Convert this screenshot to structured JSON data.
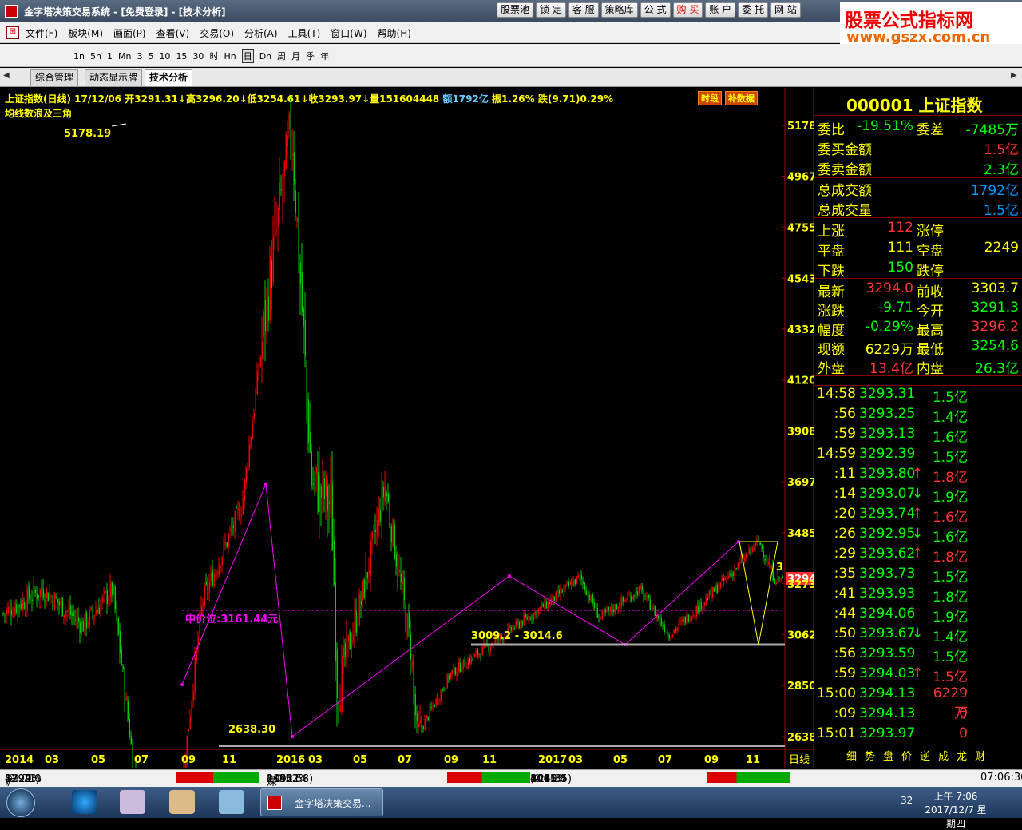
{
  "window": {
    "title": "金字塔决策交易系统 - [免费登录] - [技术分析]"
  },
  "topbuttons": [
    "股票池",
    "锁 定",
    "客 服",
    "策略库",
    "公 式",
    "购 买",
    "账 户",
    "委 托",
    "网 站"
  ],
  "watermark": {
    "line1": "股票公式指标网",
    "line2": "www.gszx.com.cn"
  },
  "menu": [
    "文件(F)",
    "板块(M)",
    "画面(P)",
    "查看(V)",
    "交易(O)",
    "分析(A)",
    "工具(T)",
    "窗口(W)",
    "帮助(H)"
  ],
  "periods": [
    "1n",
    "5n",
    "1",
    "Mn",
    "3",
    "5",
    "10",
    "15",
    "30",
    "时",
    "Hn",
    "日",
    "Dn",
    "周",
    "月",
    "季",
    "年"
  ],
  "tabs": [
    "综合管理",
    "动态显示牌",
    "技术分析"
  ],
  "chart": {
    "header": {
      "name": "上证指数(日线)",
      "date": "17/12/06",
      "open": "开3291.31",
      "high": "↓高3296.20",
      "low": "↓低3254.61",
      "close": "↓收3293.97",
      "vol": "↓量151604448",
      "amt": "额1792亿",
      "amp": "振1.26%",
      "chg": "跌(9.71)0.29%"
    },
    "indicator": "均线数浪及三角",
    "buttons": [
      "时段",
      "补数据"
    ],
    "annotations": {
      "peak": "5178.19",
      "trough": "2638.30",
      "price_level": "中价位:3161.44元",
      "range": "3009.2 - 3014.6",
      "current": "3294",
      "edge": "3"
    },
    "y_ticks": [
      "5178",
      "4967",
      "4755",
      "4543",
      "4332",
      "4120",
      "3908",
      "3697",
      "3485",
      "3273",
      "3062",
      "2850",
      "2638"
    ],
    "x_ticks": [
      "2014",
      "03",
      "05",
      "07",
      "09",
      "11",
      "2016",
      "03",
      "05",
      "07",
      "09",
      "11",
      "2017",
      "03",
      "05",
      "07",
      "09",
      "11"
    ],
    "period_label": "日线"
  },
  "chart_data": {
    "type": "candlestick",
    "series": [
      {
        "name": "上证指数(日线)",
        "points": [
          [
            2014.7,
            2200
          ],
          [
            2014.9,
            2450
          ],
          [
            2015.0,
            3200
          ],
          [
            2015.2,
            3600
          ],
          [
            2015.35,
            4600
          ],
          [
            2015.45,
            5178.19
          ],
          [
            2015.55,
            3700
          ],
          [
            2015.65,
            3600
          ],
          [
            2015.68,
            2850
          ],
          [
            2015.8,
            3200
          ],
          [
            2015.92,
            3680
          ],
          [
            2016.05,
            3000
          ],
          [
            2016.08,
            2638.3
          ],
          [
            2016.25,
            2900
          ],
          [
            2016.5,
            3050
          ],
          [
            2016.75,
            3200
          ],
          [
            2016.9,
            3301
          ],
          [
            2017.0,
            3130
          ],
          [
            2017.2,
            3250
          ],
          [
            2017.35,
            3060
          ],
          [
            2017.5,
            3180
          ],
          [
            2017.7,
            3350
          ],
          [
            2017.8,
            3450
          ],
          [
            2017.88,
            3294
          ]
        ]
      }
    ],
    "ylim": [
      2638,
      5178
    ]
  },
  "right_panel": {
    "code": "000001",
    "name": "上证指数",
    "rows": [
      {
        "l1": "委比",
        "v1": "-19.51%",
        "l2": "委差",
        "v2": "-7485万"
      },
      {
        "l1": "委买金额",
        "v1": "1.5亿"
      },
      {
        "l1": "委卖金额",
        "v1": "2.3亿"
      },
      {
        "l1": "总成交额",
        "v1": "1792亿"
      },
      {
        "l1": "总成交量",
        "v1": "1.5亿"
      },
      {
        "l1": "上涨",
        "v1": "112",
        "l2": "涨停",
        "v2": ""
      },
      {
        "l1": "平盘",
        "v1": "111",
        "l2": "空盘",
        "v2": "2249"
      },
      {
        "l1": "下跌",
        "v1": "150",
        "l2": "跌停",
        "v2": ""
      },
      {
        "l1": "最新",
        "v1": "3294.0",
        "l2": "前收",
        "v2": "3303.7"
      },
      {
        "l1": "涨跌",
        "v1": "-9.71",
        "l2": "今开",
        "v2": "3291.3"
      },
      {
        "l1": "幅度",
        "v1": "-0.29%",
        "l2": "最高",
        "v2": "3296.2"
      },
      {
        "l1": "现额",
        "v1": "6229万",
        "l2": "最低",
        "v2": "3254.6"
      },
      {
        "l1": "外盘",
        "v1": "13.4亿",
        "l2": "内盘",
        "v2": "26.3亿"
      }
    ],
    "ticks": [
      {
        "t": "14:58",
        "p": "3293.31",
        "a": "",
        "v": "1.5亿"
      },
      {
        "t": ":56",
        "p": "3293.25",
        "a": "",
        "v": "1.4亿"
      },
      {
        "t": ":59",
        "p": "3293.13",
        "a": "",
        "v": "1.6亿"
      },
      {
        "t": "14:59",
        "p": "3292.39",
        "a": "",
        "v": "1.5亿"
      },
      {
        "t": ":11",
        "p": "3293.80",
        "a": "↑",
        "v": "1.8亿"
      },
      {
        "t": ":14",
        "p": "3293.07",
        "a": "↓",
        "v": "1.9亿"
      },
      {
        "t": ":20",
        "p": "3293.74",
        "a": "↑",
        "v": "1.6亿"
      },
      {
        "t": ":26",
        "p": "3292.95",
        "a": "↓",
        "v": "1.6亿"
      },
      {
        "t": ":29",
        "p": "3293.62",
        "a": "↑",
        "v": "1.8亿"
      },
      {
        "t": ":35",
        "p": "3293.73",
        "a": "",
        "v": "1.5亿"
      },
      {
        "t": ":41",
        "p": "3293.93",
        "a": "",
        "v": "1.8亿"
      },
      {
        "t": ":44",
        "p": "3294.06",
        "a": "",
        "v": "1.9亿"
      },
      {
        "t": ":50",
        "p": "3293.67",
        "a": "↓",
        "v": "1.4亿"
      },
      {
        "t": ":56",
        "p": "3293.59",
        "a": "",
        "v": "1.5亿"
      },
      {
        "t": ":59",
        "p": "3294.03",
        "a": "↑",
        "v": "1.5亿"
      },
      {
        "t": "15:00",
        "p": "3294.13",
        "a": "",
        "v": "6229万"
      },
      {
        "t": ":09",
        "p": "3294.13",
        "a": "",
        "v": "0"
      },
      {
        "t": "15:01",
        "p": "3293.97",
        "a": "",
        "v": "0"
      }
    ],
    "bottom_tabs": [
      "细",
      "势",
      "盘",
      "价",
      "逆",
      "成",
      "龙",
      "财"
    ]
  },
  "status": {
    "sh": {
      "name": "沪",
      "price": "3294.0",
      "pct": "-0.29%",
      "chg": "(-9.71)",
      "amt": "1792亿"
    },
    "sz": {
      "name": "深",
      "price": "10911",
      "pct": "+0.52%",
      "chg": "(+56.58)",
      "amt": "2142亿"
    },
    "i300": {
      "name": "300",
      "price": "4015.8",
      "pct": "-0.60%",
      "chg": "(-24.35)",
      "amt": "1441亿"
    },
    "time": "07:06:30"
  },
  "taskbar": {
    "app": "金字塔决策交易...",
    "clock_time": "上午 7:06",
    "clock_date": "2017/12/7 星期四",
    "badge": "32"
  }
}
